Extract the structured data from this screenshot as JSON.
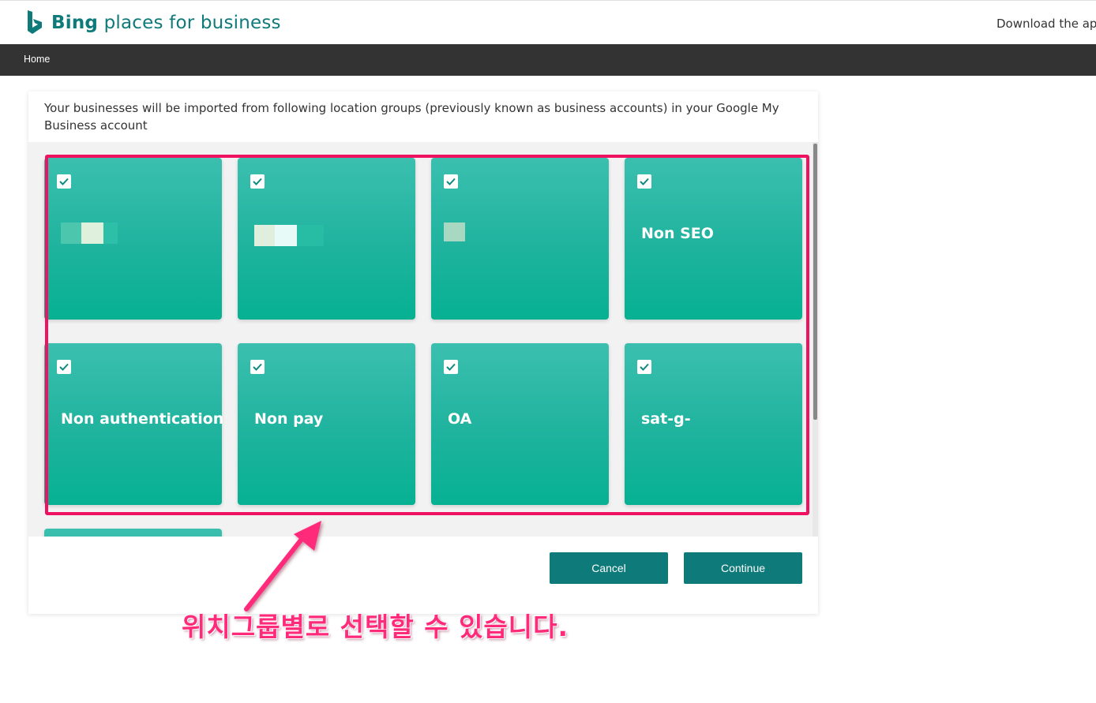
{
  "header": {
    "brand_bold": "Bing",
    "brand_rest": " places for business",
    "download_link": "Download the app"
  },
  "nav": {
    "home": "Home"
  },
  "panel": {
    "intro": "Your businesses will be imported from following location groups (previously known as business accounts) in your Google My Business account"
  },
  "groups": [
    {
      "label": "",
      "checked": true,
      "redacted": true
    },
    {
      "label": "",
      "checked": true,
      "redacted": true
    },
    {
      "label": "",
      "checked": true,
      "redacted": true
    },
    {
      "label": "Non SEO",
      "checked": true
    },
    {
      "label": "Non authentication",
      "checked": true
    },
    {
      "label": "Non pay",
      "checked": true
    },
    {
      "label": "OA",
      "checked": true
    },
    {
      "label": "sat-g-",
      "checked": true
    }
  ],
  "buttons": {
    "cancel": "Cancel",
    "continue": "Continue"
  },
  "annotation": {
    "text": "위치그룹별로 선택할 수 있습니다.",
    "color": "#ee1261"
  },
  "colors": {
    "brand": "#0f7a7a",
    "card": "#1fb39e",
    "nav": "#333333",
    "button": "#0e7a7a"
  }
}
